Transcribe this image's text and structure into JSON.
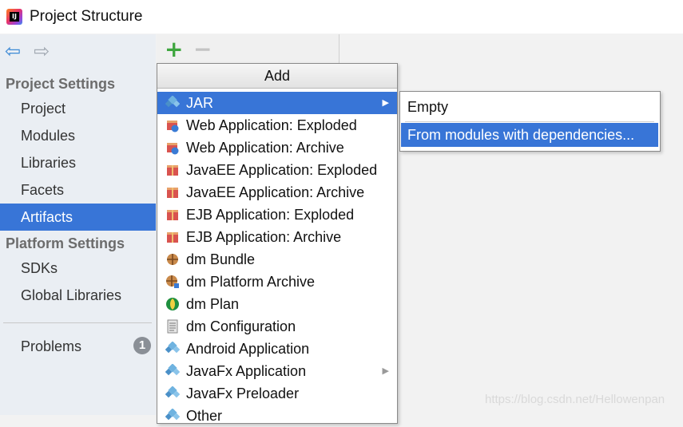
{
  "window": {
    "title": "Project Structure",
    "logo_text": "IJ"
  },
  "nav": {
    "back_icon": "arrow-left-icon",
    "forward_icon": "arrow-right-icon"
  },
  "sidebar": {
    "project_settings_header": "Project Settings",
    "project_items": [
      "Project",
      "Modules",
      "Libraries",
      "Facets",
      "Artifacts"
    ],
    "platform_settings_header": "Platform Settings",
    "platform_items": [
      "SDKs",
      "Global Libraries"
    ],
    "problems_label": "Problems",
    "problems_count": "1",
    "selected": "Artifacts"
  },
  "toolbar": {
    "add_icon": "plus-icon",
    "remove_icon": "minus-icon"
  },
  "popup": {
    "header": "Add",
    "items": [
      {
        "label": "JAR",
        "icon": "jar-icon",
        "submenu": true,
        "selected": true
      },
      {
        "label": "Web Application: Exploded",
        "icon": "web-app-icon",
        "submenu": false
      },
      {
        "label": "Web Application: Archive",
        "icon": "web-app-icon",
        "submenu": false
      },
      {
        "label": "JavaEE Application: Exploded",
        "icon": "javaee-icon",
        "submenu": false
      },
      {
        "label": "JavaEE Application: Archive",
        "icon": "javaee-icon",
        "submenu": false
      },
      {
        "label": "EJB Application: Exploded",
        "icon": "ejb-icon",
        "submenu": false
      },
      {
        "label": "EJB Application: Archive",
        "icon": "ejb-icon",
        "submenu": false
      },
      {
        "label": "dm Bundle",
        "icon": "bundle-icon",
        "submenu": false
      },
      {
        "label": "dm Platform Archive",
        "icon": "platform-archive-icon",
        "submenu": false
      },
      {
        "label": "dm Plan",
        "icon": "plan-icon",
        "submenu": false
      },
      {
        "label": "dm Configuration",
        "icon": "configuration-icon",
        "submenu": false
      },
      {
        "label": "Android Application",
        "icon": "android-icon",
        "submenu": false
      },
      {
        "label": "JavaFx Application",
        "icon": "javafx-icon",
        "submenu": true
      },
      {
        "label": "JavaFx Preloader",
        "icon": "javafx-icon",
        "submenu": false
      },
      {
        "label": "Other",
        "icon": "other-icon",
        "submenu": false
      }
    ]
  },
  "submenu": {
    "items": [
      {
        "label": "Empty",
        "selected": false
      },
      {
        "label": "From modules with dependencies...",
        "selected": true
      }
    ]
  },
  "watermark": "https://blog.csdn.net/Hellowenpan",
  "colors": {
    "selection": "#3875d7",
    "add_green": "#3fa63f",
    "sidebar_bg": "#eaeef3"
  }
}
